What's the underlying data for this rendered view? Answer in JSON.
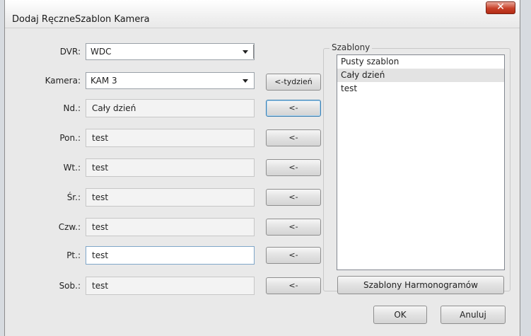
{
  "window": {
    "title": "Dodaj RęczneSzablon Kamera"
  },
  "dvr": {
    "label": "DVR:",
    "value": "WDC"
  },
  "camera": {
    "label": "Kamera:",
    "value": "KAM 3",
    "week_button": "<-tydzień"
  },
  "days": [
    {
      "label": "Nd.:",
      "value": "Cały dzień",
      "button": "<-"
    },
    {
      "label": "Pon.:",
      "value": "test",
      "button": "<-"
    },
    {
      "label": "Wt.:",
      "value": "test",
      "button": "<-"
    },
    {
      "label": "Śr.:",
      "value": "test",
      "button": "<-"
    },
    {
      "label": "Czw.:",
      "value": "test",
      "button": "<-"
    },
    {
      "label": "Pt.:",
      "value": "test",
      "button": "<-"
    },
    {
      "label": "Sob.:",
      "value": "test",
      "button": "<-"
    }
  ],
  "templates": {
    "title": "Szablony",
    "items": [
      "Pusty szablon",
      "Cały dzień",
      "test"
    ],
    "selected_index": 1,
    "schedules_button": "Szablony Harmonogramów"
  },
  "footer": {
    "ok": "OK",
    "cancel": "Anuluj"
  }
}
